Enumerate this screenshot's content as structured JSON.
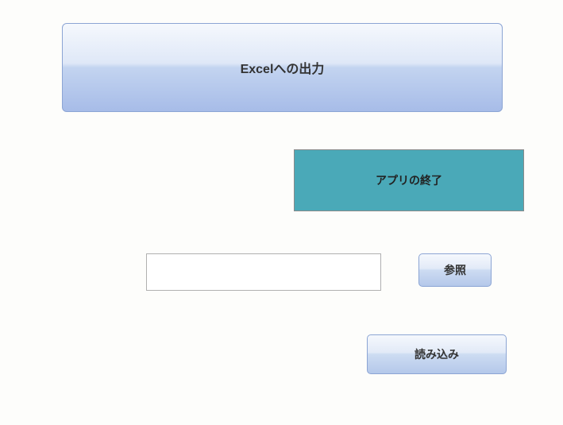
{
  "buttons": {
    "export_label": "Excelへの出力",
    "quit_label": "アプリの終了",
    "browse_label": "参照",
    "load_label": "読み込み"
  },
  "inputs": {
    "file_path": ""
  }
}
